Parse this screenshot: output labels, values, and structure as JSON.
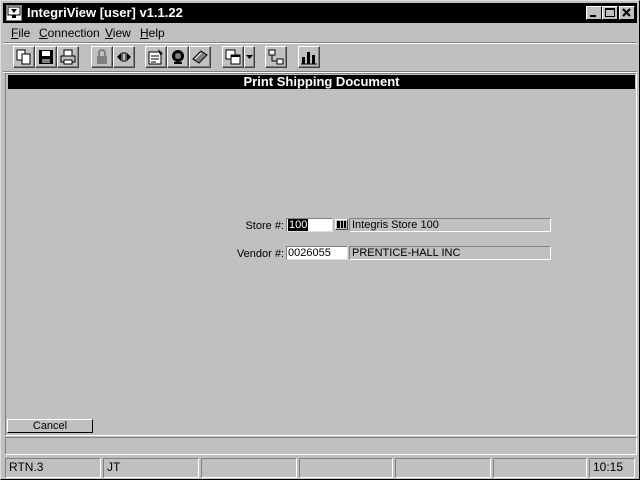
{
  "window": {
    "title": "IntegriView [user]  v1.1.22",
    "buttons": {
      "minimize": "_",
      "maximize": "□",
      "close": "✕"
    }
  },
  "menu": {
    "items": [
      {
        "accel": "F",
        "rest": "ile"
      },
      {
        "accel": "C",
        "rest": "onnection"
      },
      {
        "accel": "V",
        "rest": "iew"
      },
      {
        "accel": "H",
        "rest": "elp"
      }
    ]
  },
  "toolbar": {
    "icons": [
      "copy-icon",
      "save-icon",
      "print-icon",
      "lock-icon",
      "connect-icon",
      "properties-icon",
      "monitor-icon",
      "book-icon",
      "windows-icon",
      "dropdown-arrow-icon",
      "network-icon",
      "chart-icon"
    ]
  },
  "form": {
    "title": "Print Shipping Document",
    "store": {
      "label": "Store #:",
      "value": "100",
      "lookup_icon": "lookup-icon",
      "description": "Integris Store 100"
    },
    "vendor": {
      "label": "Vendor #:",
      "value": "0026055",
      "description": "PRENTICE-HALL INC"
    },
    "cancel_label": "Cancel"
  },
  "message_line": "",
  "status": {
    "cells": [
      "RTN.3",
      "JT",
      "",
      "",
      "",
      "",
      "10:15"
    ]
  }
}
